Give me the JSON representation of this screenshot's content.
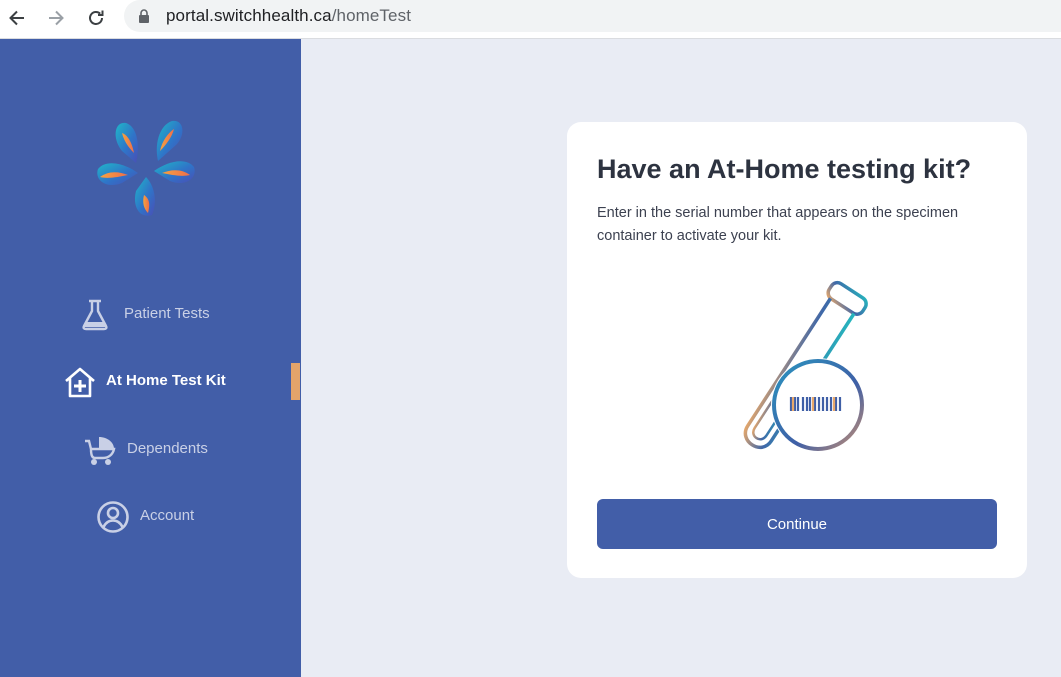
{
  "browser": {
    "url_domain": "portal.switchhealth.ca",
    "url_path": "/homeTest",
    "back_icon": "arrow-left-icon",
    "forward_icon": "arrow-right-icon",
    "reload_icon": "reload-icon",
    "lock_icon": "lock-icon"
  },
  "sidebar": {
    "background": "#425ea8",
    "active_marker_color": "#e3a46a",
    "items": [
      {
        "label": "Patient Tests",
        "icon": "flask-icon"
      },
      {
        "label": "At Home Test Kit",
        "icon": "home-plus-icon"
      },
      {
        "label": "Dependents",
        "icon": "stroller-icon"
      },
      {
        "label": "Account",
        "icon": "user-circle-icon"
      }
    ],
    "active_item": "At Home Test Kit"
  },
  "card": {
    "title": "Have an At-Home testing kit?",
    "description": "Enter in the serial number that appears on the specimen container to activate your kit.",
    "illustration": "test-tube-magnifier-illustration",
    "button_label": "Continue",
    "button_color": "#425ea8"
  }
}
